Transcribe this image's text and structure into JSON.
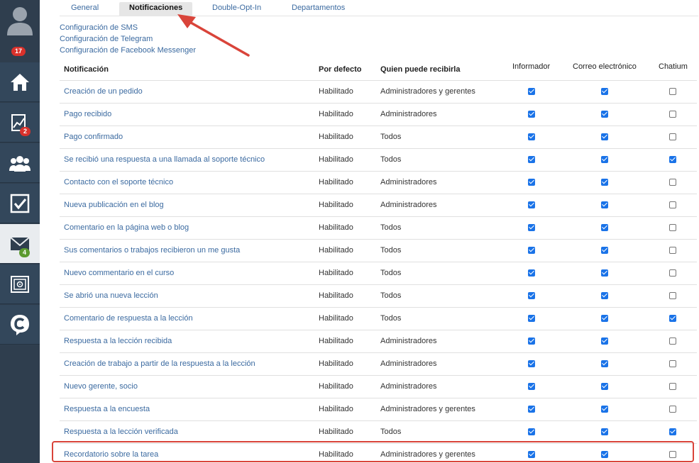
{
  "sidebar": {
    "avatar_icon": "user-avatar-icon",
    "notifications_badge": "17",
    "items": [
      {
        "name": "home",
        "icon": "home-icon",
        "badge": ""
      },
      {
        "name": "analytics",
        "icon": "chart-icon",
        "badge": "2"
      },
      {
        "name": "users",
        "icon": "users-icon",
        "badge": ""
      },
      {
        "name": "tasks",
        "icon": "checkbox-icon",
        "badge": ""
      },
      {
        "name": "messages",
        "icon": "mail-icon",
        "badge": "4"
      },
      {
        "name": "safe",
        "icon": "safe-icon",
        "badge": ""
      },
      {
        "name": "chatium",
        "icon": "chatium-logo-icon",
        "badge": ""
      }
    ]
  },
  "tabs": [
    {
      "label": "General",
      "active": false
    },
    {
      "label": "Notificaciones",
      "active": true
    },
    {
      "label": "Double-Opt-In",
      "active": false
    },
    {
      "label": "Departamentos",
      "active": false
    }
  ],
  "config_links": [
    "Configuración de SMS",
    "Configuración de Telegram",
    "Configuración de Facebook Messenger"
  ],
  "table": {
    "headers": {
      "notification": "Notificación",
      "default": "Por defecto",
      "who": "Quien puede recibirla",
      "informer": "Informador",
      "email": "Correo electrónico",
      "chatium": "Chatium"
    },
    "rows": [
      {
        "name": "Creación de un pedido",
        "default": "Habilitado",
        "who": "Administradores y gerentes",
        "informer": true,
        "email": true,
        "chatium": false
      },
      {
        "name": "Pago recibido",
        "default": "Habilitado",
        "who": "Administradores",
        "informer": true,
        "email": true,
        "chatium": false
      },
      {
        "name": "Pago confirmado",
        "default": "Habilitado",
        "who": "Todos",
        "informer": true,
        "email": true,
        "chatium": false
      },
      {
        "name": "Se recibió una respuesta a una llamada al soporte técnico",
        "default": "Habilitado",
        "who": "Todos",
        "informer": true,
        "email": true,
        "chatium": true
      },
      {
        "name": "Contacto con el soporte técnico",
        "default": "Habilitado",
        "who": "Administradores",
        "informer": true,
        "email": true,
        "chatium": false
      },
      {
        "name": "Nueva publicación en el blog",
        "default": "Habilitado",
        "who": "Administradores",
        "informer": true,
        "email": true,
        "chatium": false
      },
      {
        "name": "Comentario en la página web o blog",
        "default": "Habilitado",
        "who": "Todos",
        "informer": true,
        "email": true,
        "chatium": false
      },
      {
        "name": "Sus comentarios o trabajos recibieron un me gusta",
        "default": "Habilitado",
        "who": "Todos",
        "informer": true,
        "email": true,
        "chatium": false
      },
      {
        "name": "Nuevo commentario en el curso",
        "default": "Habilitado",
        "who": "Todos",
        "informer": true,
        "email": true,
        "chatium": false
      },
      {
        "name": "Se abrió una nueva lección",
        "default": "Habilitado",
        "who": "Todos",
        "informer": true,
        "email": true,
        "chatium": false
      },
      {
        "name": "Comentario de respuesta a la lección",
        "default": "Habilitado",
        "who": "Todos",
        "informer": true,
        "email": true,
        "chatium": true
      },
      {
        "name": "Respuesta a la lección recibida",
        "default": "Habilitado",
        "who": "Administradores",
        "informer": true,
        "email": true,
        "chatium": false
      },
      {
        "name": "Creación de trabajo a partir de la respuesta a la lección",
        "default": "Habilitado",
        "who": "Administradores",
        "informer": true,
        "email": true,
        "chatium": false
      },
      {
        "name": "Nuevo gerente, socio",
        "default": "Habilitado",
        "who": "Administradores",
        "informer": true,
        "email": true,
        "chatium": false
      },
      {
        "name": "Respuesta a la encuesta",
        "default": "Habilitado",
        "who": "Administradores y gerentes",
        "informer": true,
        "email": true,
        "chatium": false
      },
      {
        "name": "Respuesta a la lección verificada",
        "default": "Habilitado",
        "who": "Todos",
        "informer": true,
        "email": true,
        "chatium": true
      },
      {
        "name": "Recordatorio sobre la tarea",
        "default": "Habilitado",
        "who": "Administradores y gerentes",
        "informer": true,
        "email": true,
        "chatium": false
      }
    ]
  },
  "annotation_color": "#d9443a",
  "checkbox_color": "#1a73e8"
}
